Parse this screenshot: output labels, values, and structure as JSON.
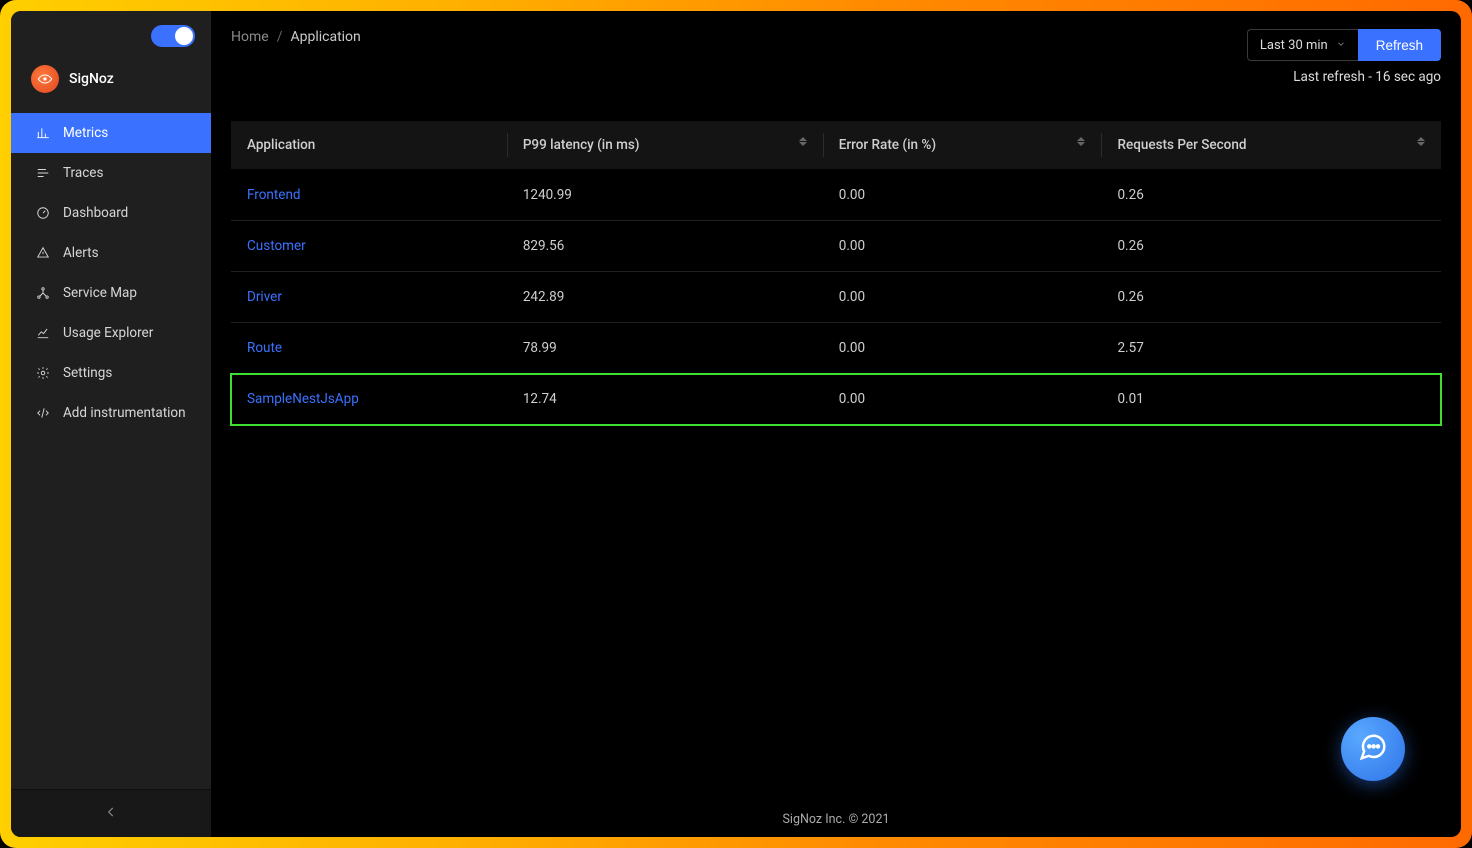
{
  "brand": {
    "name": "SigNoz"
  },
  "sidebar": {
    "items": [
      {
        "label": "Metrics"
      },
      {
        "label": "Traces"
      },
      {
        "label": "Dashboard"
      },
      {
        "label": "Alerts"
      },
      {
        "label": "Service Map"
      },
      {
        "label": "Usage Explorer"
      },
      {
        "label": "Settings"
      },
      {
        "label": "Add instrumentation"
      }
    ]
  },
  "breadcrumbs": {
    "home": "Home",
    "current": "Application"
  },
  "controls": {
    "time_range": "Last 30 min",
    "refresh_label": "Refresh",
    "last_refresh": "Last refresh - 16 sec ago"
  },
  "table": {
    "columns": [
      {
        "label": "Application",
        "sortable": false
      },
      {
        "label": "P99 latency (in ms)",
        "sortable": true
      },
      {
        "label": "Error Rate (in %)",
        "sortable": true
      },
      {
        "label": "Requests Per Second",
        "sortable": true
      }
    ],
    "rows": [
      {
        "app": "Frontend",
        "p99": "1240.99",
        "err": "0.00",
        "rps": "0.26",
        "highlight": false
      },
      {
        "app": "Customer",
        "p99": "829.56",
        "err": "0.00",
        "rps": "0.26",
        "highlight": false
      },
      {
        "app": "Driver",
        "p99": "242.89",
        "err": "0.00",
        "rps": "0.26",
        "highlight": false
      },
      {
        "app": "Route",
        "p99": "78.99",
        "err": "0.00",
        "rps": "2.57",
        "highlight": false
      },
      {
        "app": "SampleNestJsApp",
        "p99": "12.74",
        "err": "0.00",
        "rps": "0.01",
        "highlight": true
      }
    ]
  },
  "footer": {
    "text": "SigNoz Inc. © 2021"
  }
}
